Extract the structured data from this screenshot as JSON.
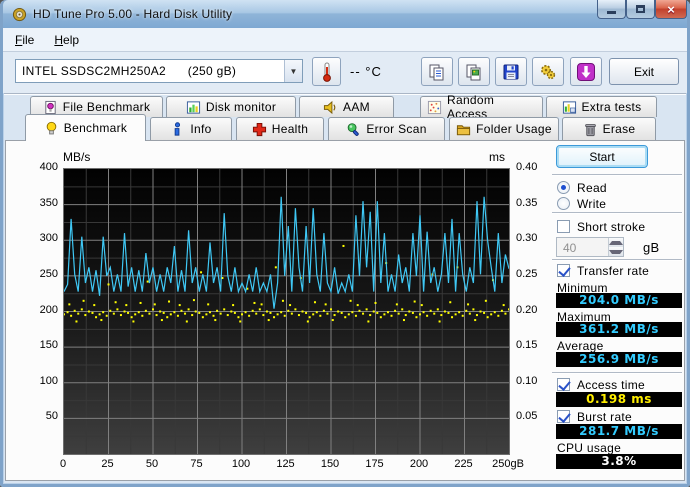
{
  "window": {
    "title": "HD Tune Pro 5.00 - Hard Disk Utility"
  },
  "menu": {
    "items": [
      "File",
      "Help"
    ]
  },
  "toolbar": {
    "drive_selected": "INTEL SSDSC2MH250A2      (250 gB)",
    "temperature": "-- °C",
    "exit_label": "Exit"
  },
  "tabs": {
    "row1": [
      "File Benchmark",
      "Disk monitor",
      "AAM",
      "Random Access",
      "Extra tests"
    ],
    "row2": [
      "Benchmark",
      "Info",
      "Health",
      "Error Scan",
      "Folder Usage",
      "Erase"
    ],
    "active": "Benchmark"
  },
  "panel": {
    "start_label": "Start",
    "read_label": "Read",
    "write_label": "Write",
    "read_selected": true,
    "short_stroke_label": "Short stroke",
    "short_stroke_checked": false,
    "short_stroke_value": "40",
    "short_stroke_unit": "gB",
    "transfer_rate_label": "Transfer rate",
    "transfer_rate_checked": true,
    "minimum_label": "Minimum",
    "minimum_value": "204.0 MB/s",
    "maximum_label": "Maximum",
    "maximum_value": "361.2 MB/s",
    "average_label": "Average",
    "average_value": "256.9 MB/s",
    "access_time_label": "Access time",
    "access_time_checked": true,
    "access_time_value": "0.198 ms",
    "burst_rate_label": "Burst rate",
    "burst_rate_checked": true,
    "burst_rate_value": "281.7 MB/s",
    "cpu_usage_label": "CPU usage",
    "cpu_usage_value": "3.8%"
  },
  "chart_data": {
    "type": "line",
    "grid": true,
    "y_left": {
      "label": "MB/s",
      "min": 0,
      "max": 400,
      "major_step": 50,
      "minor_step": 25,
      "ticks": [
        400,
        350,
        300,
        250,
        200,
        150,
        100,
        50
      ]
    },
    "y_right": {
      "label": "ms",
      "min": 0,
      "max": 0.4,
      "ticks": [
        "0.40",
        "0.35",
        "0.30",
        "0.25",
        "0.20",
        "0.15",
        "0.10",
        "0.05"
      ]
    },
    "x": {
      "min": 0,
      "max": 250,
      "major_step": 25,
      "minor_step": 12.5,
      "ticks": [
        {
          "gb": 0,
          "label": "0"
        },
        {
          "gb": 25,
          "label": "25"
        },
        {
          "gb": 50,
          "label": "50"
        },
        {
          "gb": 75,
          "label": "75"
        },
        {
          "gb": 100,
          "label": "100"
        },
        {
          "gb": 125,
          "label": "125"
        },
        {
          "gb": 150,
          "label": "150"
        },
        {
          "gb": 175,
          "label": "175"
        },
        {
          "gb": 200,
          "label": "200"
        },
        {
          "gb": 225,
          "label": "225"
        },
        {
          "gb": 250,
          "label": "250gB"
        }
      ]
    },
    "series": [
      {
        "name": "transfer-rate",
        "color": "#3fc8f5",
        "unit": "MB/s",
        "axis": "left",
        "x_step_gb": 2,
        "values": [
          228,
          238,
          330,
          252,
          228,
          305,
          240,
          262,
          228,
          258,
          222,
          305,
          250,
          262,
          228,
          252,
          228,
          310,
          235,
          262,
          228,
          258,
          228,
          282,
          240,
          262,
          228,
          252,
          228,
          262,
          240,
          292,
          228,
          258,
          228,
          314,
          240,
          262,
          228,
          252,
          228,
          297,
          240,
          262,
          228,
          338,
          250,
          228,
          262,
          228,
          240,
          228,
          252,
          228,
          262,
          228,
          240,
          228,
          252,
          204,
          240,
          361,
          250,
          320,
          228,
          345,
          262,
          228,
          320,
          240,
          345,
          252,
          228,
          310,
          240,
          228,
          262,
          225,
          240,
          228,
          252,
          228,
          335,
          250,
          355,
          262,
          340,
          228,
          355,
          240,
          310,
          228,
          252,
          228,
          280,
          240,
          262,
          228,
          310,
          250,
          335,
          228,
          312,
          240,
          262,
          228,
          252,
          310,
          240,
          330,
          228,
          310,
          252,
          228,
          262,
          240,
          355,
          252,
          361,
          300,
          262,
          228,
          310,
          240,
          280,
          260
        ]
      },
      {
        "name": "access-time",
        "color": "#ffff00",
        "unit": "ms",
        "axis": "right",
        "x_step_gb": 2,
        "values": [
          0.196,
          0.199,
          0.194,
          0.201,
          0.197,
          0.203,
          0.195,
          0.2,
          0.198,
          0.192,
          0.196,
          0.199,
          0.194,
          0.201,
          0.197,
          0.203,
          0.195,
          0.2,
          0.198,
          0.192,
          0.196,
          0.199,
          0.194,
          0.201,
          0.197,
          0.203,
          0.195,
          0.2,
          0.198,
          0.192,
          0.196,
          0.199,
          0.194,
          0.201,
          0.197,
          0.203,
          0.195,
          0.2,
          0.198,
          0.192,
          0.196,
          0.199,
          0.194,
          0.201,
          0.197,
          0.203,
          0.195,
          0.2,
          0.198,
          0.192,
          0.196,
          0.199,
          0.194,
          0.201,
          0.197,
          0.203,
          0.195,
          0.2,
          0.198,
          0.192,
          0.196,
          0.199,
          0.194,
          0.201,
          0.197,
          0.203,
          0.195,
          0.2,
          0.198,
          0.192,
          0.196,
          0.199,
          0.194,
          0.201,
          0.197,
          0.203,
          0.195,
          0.2,
          0.198,
          0.192,
          0.196,
          0.199,
          0.194,
          0.201,
          0.197,
          0.203,
          0.195,
          0.2,
          0.198,
          0.192,
          0.196,
          0.199,
          0.194,
          0.201,
          0.197,
          0.203,
          0.195,
          0.2,
          0.198,
          0.192,
          0.196,
          0.199,
          0.194,
          0.201,
          0.197,
          0.203,
          0.195,
          0.2,
          0.198,
          0.192,
          0.196,
          0.199,
          0.194,
          0.201,
          0.197,
          0.203,
          0.195,
          0.2,
          0.198,
          0.192,
          0.196,
          0.199,
          0.194,
          0.201,
          0.197,
          0.203
        ],
        "extra_points": [
          [
            3,
            0.21
          ],
          [
            7,
            0.186
          ],
          [
            11,
            0.215
          ],
          [
            17,
            0.209
          ],
          [
            21,
            0.188
          ],
          [
            25,
            0.238
          ],
          [
            29,
            0.213
          ],
          [
            35,
            0.209
          ],
          [
            39,
            0.186
          ],
          [
            43,
            0.212
          ],
          [
            47,
            0.242
          ],
          [
            51,
            0.21
          ],
          [
            55,
            0.188
          ],
          [
            59,
            0.214
          ],
          [
            65,
            0.209
          ],
          [
            69,
            0.186
          ],
          [
            73,
            0.216
          ],
          [
            77,
            0.255
          ],
          [
            81,
            0.21
          ],
          [
            85,
            0.188
          ],
          [
            89,
            0.247
          ],
          [
            95,
            0.209
          ],
          [
            99,
            0.186
          ],
          [
            103,
            0.232
          ],
          [
            107,
            0.212
          ],
          [
            111,
            0.21
          ],
          [
            115,
            0.188
          ],
          [
            119,
            0.262
          ],
          [
            123,
            0.215
          ],
          [
            127,
            0.209
          ],
          [
            133,
            0.247
          ],
          [
            137,
            0.186
          ],
          [
            141,
            0.213
          ],
          [
            147,
            0.21
          ],
          [
            151,
            0.188
          ],
          [
            157,
            0.292
          ],
          [
            161,
            0.215
          ],
          [
            165,
            0.209
          ],
          [
            171,
            0.186
          ],
          [
            175,
            0.212
          ],
          [
            181,
            0.268
          ],
          [
            187,
            0.21
          ],
          [
            191,
            0.188
          ],
          [
            197,
            0.214
          ],
          [
            201,
            0.209
          ],
          [
            207,
            0.252
          ],
          [
            211,
            0.186
          ],
          [
            217,
            0.213
          ],
          [
            221,
            0.262
          ],
          [
            227,
            0.21
          ],
          [
            231,
            0.188
          ],
          [
            237,
            0.215
          ],
          [
            241,
            0.244
          ],
          [
            247,
            0.209
          ]
        ]
      }
    ],
    "colors": {
      "plot_bg_top": "#020202",
      "plot_bg_bottom": "#3f3f3f",
      "grid_major": "#808080",
      "grid_minor": "#383838"
    }
  }
}
